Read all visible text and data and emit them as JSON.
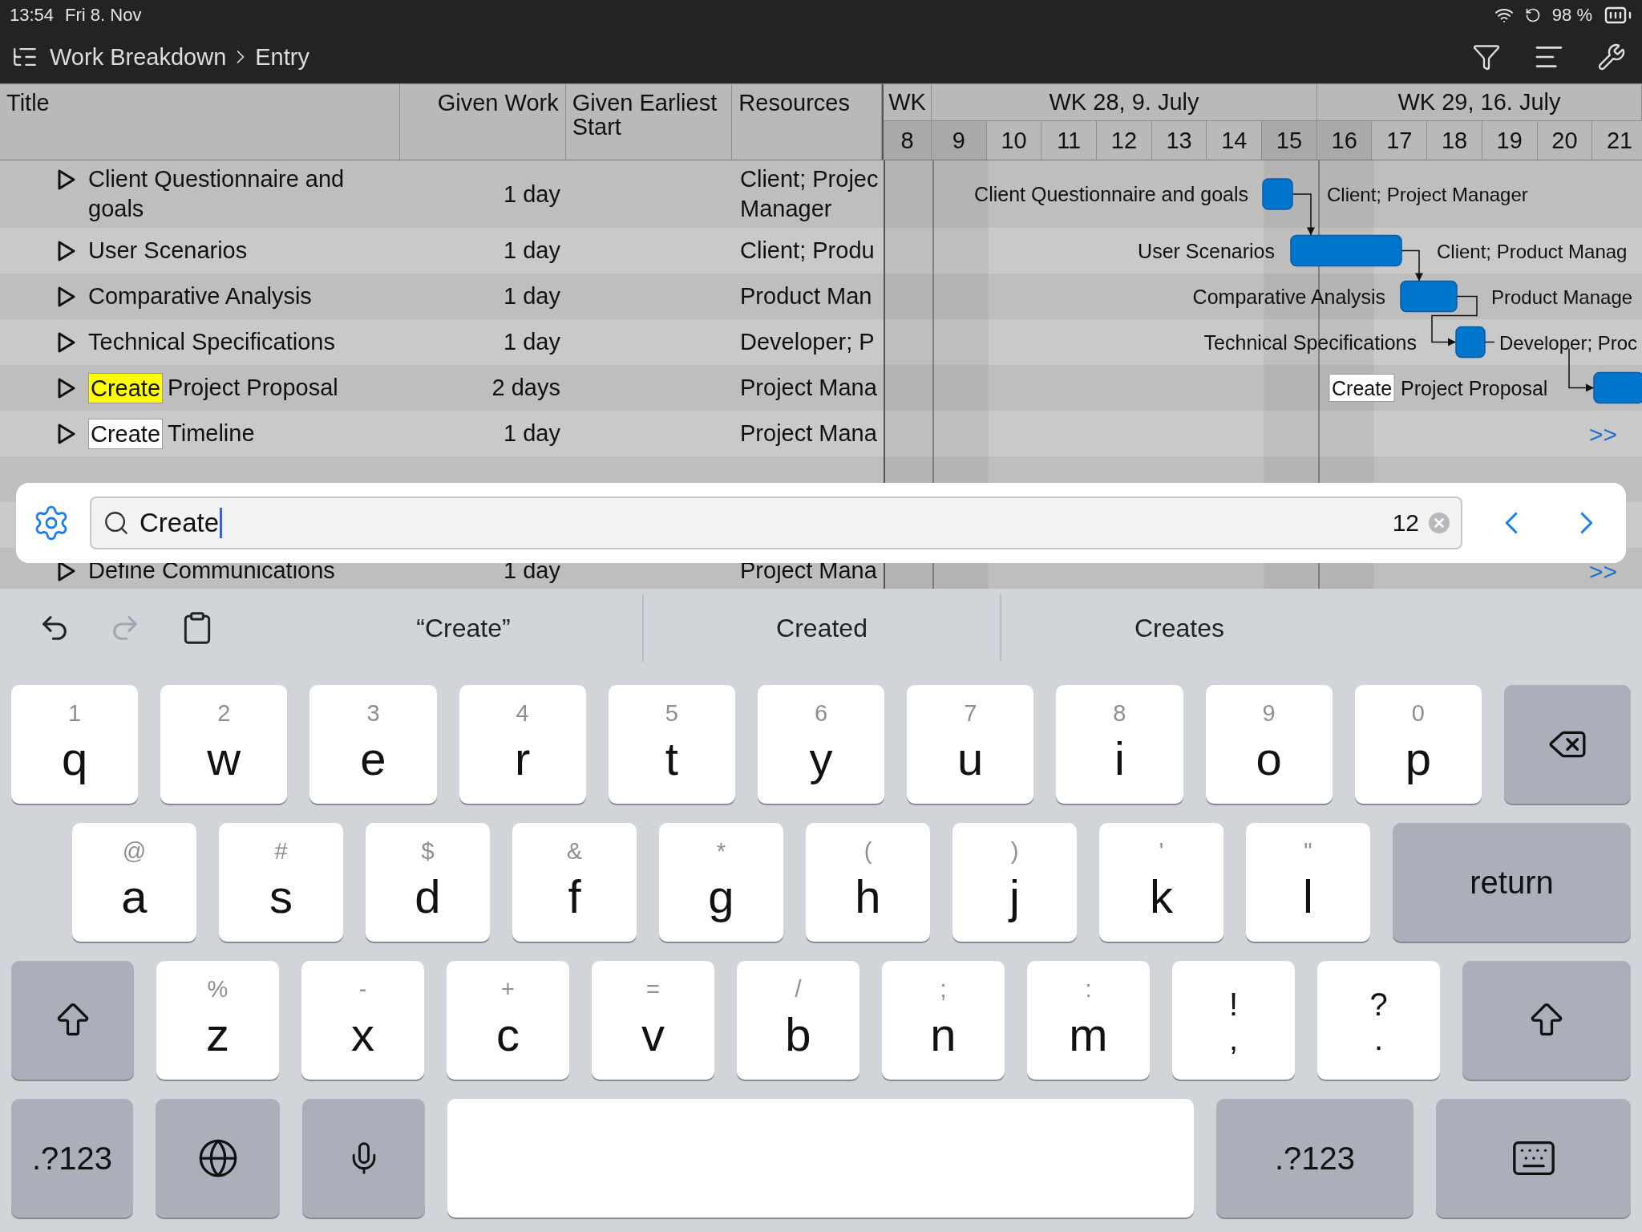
{
  "status_bar": {
    "time": "13:54",
    "date": "Fri 8. Nov",
    "battery": "98 %"
  },
  "nav": {
    "breadcrumb": [
      "Work Breakdown",
      "Entry"
    ]
  },
  "table": {
    "columns": [
      {
        "label": "Title"
      },
      {
        "label": "Given Work"
      },
      {
        "label": "Given Earliest Start"
      },
      {
        "label": "Resources"
      }
    ],
    "rows": [
      {
        "title": "Client Questionnaire and goals",
        "work": "1 day",
        "resources": [
          "Client; Projec",
          "Manager"
        ]
      },
      {
        "title": "User Scenarios",
        "work": "1 day",
        "resources": [
          "Client; Produ"
        ]
      },
      {
        "title": "Comparative Analysis",
        "work": "1 day",
        "resources": [
          "Product Man"
        ]
      },
      {
        "title": "Technical Specifications",
        "work": "1 day",
        "resources": [
          "Developer; P"
        ]
      },
      {
        "match": "Create",
        "title": "Project Proposal",
        "current": true,
        "work": "2 days",
        "resources": [
          "Project Mana"
        ]
      },
      {
        "match": "Create",
        "title": "Timeline",
        "current": false,
        "work": "1 day",
        "resources": [
          "Project Mana"
        ]
      }
    ],
    "rows_below_search": [
      {
        "title": "Define Communications",
        "work": "1 day",
        "resources": [
          "Project Mana"
        ]
      }
    ]
  },
  "gantt": {
    "first_week": "WK",
    "weeks": [
      "WK 28, 9. July",
      "WK 29, 16. July"
    ],
    "days": [
      {
        "label": "8",
        "shaded": true
      },
      {
        "label": "9",
        "shaded": true
      },
      {
        "label": "10",
        "shaded": false
      },
      {
        "label": "11",
        "shaded": false
      },
      {
        "label": "12",
        "shaded": false
      },
      {
        "label": "13",
        "shaded": false
      },
      {
        "label": "14",
        "shaded": false
      },
      {
        "label": "15",
        "shaded": true
      },
      {
        "label": "16",
        "shaded": true
      },
      {
        "label": "17",
        "shaded": false
      },
      {
        "label": "18",
        "shaded": false
      },
      {
        "label": "19",
        "shaded": false
      },
      {
        "label": "20",
        "shaded": false
      },
      {
        "label": "21",
        "shaded": false
      }
    ],
    "rows": [
      {
        "kind": "bar",
        "label": "Client Questionnaire and goals",
        "resources": "Client; Project Manager"
      },
      {
        "kind": "bar",
        "label": "User Scenarios",
        "resources": "Client; Product Manag"
      },
      {
        "kind": "bar",
        "label": "Comparative Analysis",
        "resources": "Product Manage"
      },
      {
        "kind": "bar",
        "label": "Technical Specifications",
        "resources": "Developer; Proc"
      },
      {
        "kind": "bar",
        "match": "Create",
        "label": "Project Proposal"
      },
      {
        "kind": "more",
        "text": ">>"
      }
    ],
    "rows_below_search": [
      {
        "kind": "more",
        "text": ">>"
      }
    ]
  },
  "search": {
    "value": "Create",
    "count": "12"
  },
  "keyboard": {
    "actions": [
      {
        "kind": "undo",
        "disabled": false
      },
      {
        "kind": "redo",
        "disabled": true
      },
      {
        "kind": "paste",
        "disabled": false
      }
    ],
    "suggestions": [
      "“Create”",
      "Created",
      "Creates"
    ],
    "rows": [
      [
        {
          "kind": "letter",
          "hint": "1",
          "label": "q"
        },
        {
          "kind": "letter",
          "hint": "2",
          "label": "w"
        },
        {
          "kind": "letter",
          "hint": "3",
          "label": "e"
        },
        {
          "kind": "letter",
          "hint": "4",
          "label": "r"
        },
        {
          "kind": "letter",
          "hint": "5",
          "label": "t"
        },
        {
          "kind": "letter",
          "hint": "6",
          "label": "y"
        },
        {
          "kind": "letter",
          "hint": "7",
          "label": "u"
        },
        {
          "kind": "letter",
          "hint": "8",
          "label": "i"
        },
        {
          "kind": "letter",
          "hint": "9",
          "label": "o"
        },
        {
          "kind": "letter",
          "hint": "0",
          "label": "p"
        },
        {
          "kind": "backspace"
        }
      ],
      [
        {
          "kind": "letter",
          "hint": "@",
          "label": "a"
        },
        {
          "kind": "letter",
          "hint": "#",
          "label": "s"
        },
        {
          "kind": "letter",
          "hint": "$",
          "label": "d"
        },
        {
          "kind": "letter",
          "hint": "&",
          "label": "f"
        },
        {
          "kind": "letter",
          "hint": "*",
          "label": "g"
        },
        {
          "kind": "letter",
          "hint": "(",
          "label": "h"
        },
        {
          "kind": "letter",
          "hint": ")",
          "label": "j"
        },
        {
          "kind": "letter",
          "hint": "'",
          "label": "k"
        },
        {
          "kind": "letter",
          "hint": "\"",
          "label": "l"
        },
        {
          "kind": "return",
          "label": "return"
        }
      ],
      [
        {
          "kind": "shift"
        },
        {
          "kind": "letter",
          "hint": "%",
          "label": "z"
        },
        {
          "kind": "letter",
          "hint": "-",
          "label": "x"
        },
        {
          "kind": "letter",
          "hint": "+",
          "label": "c"
        },
        {
          "kind": "letter",
          "hint": "=",
          "label": "v"
        },
        {
          "kind": "letter",
          "hint": "/",
          "label": "b"
        },
        {
          "kind": "letter",
          "hint": ";",
          "label": "n"
        },
        {
          "kind": "letter",
          "hint": ":",
          "label": "m"
        },
        {
          "kind": "punct",
          "hint": "!",
          "label": ","
        },
        {
          "kind": "punct",
          "hint": "?",
          "label": "."
        },
        {
          "kind": "shift"
        }
      ],
      [
        {
          "kind": "mode",
          "label": ".?123"
        },
        {
          "kind": "globe"
        },
        {
          "kind": "mic"
        },
        {
          "kind": "space"
        },
        {
          "kind": "mode",
          "label": ".?123"
        },
        {
          "kind": "hide"
        }
      ]
    ]
  }
}
